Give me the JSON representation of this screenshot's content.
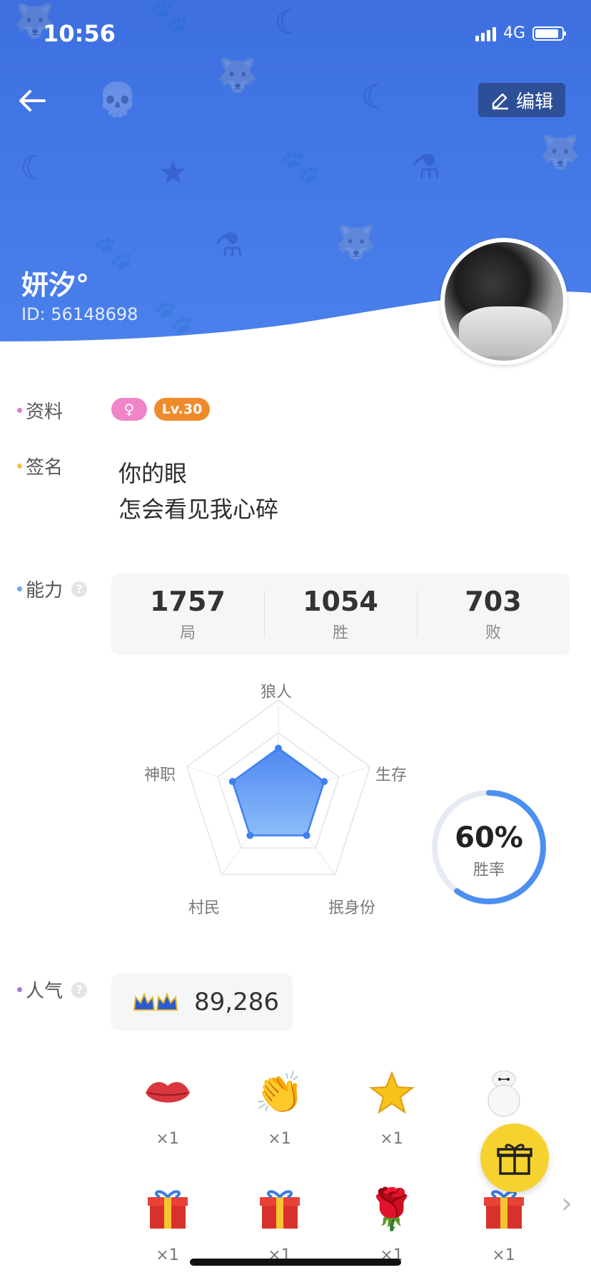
{
  "status_bar": {
    "time": "10:56",
    "network": "4G"
  },
  "header": {
    "edit_label": "编辑",
    "username": "妍汐°",
    "user_id": "ID: 56148698"
  },
  "profile": {
    "label": "资料",
    "level_badge": "Lv.30"
  },
  "signature": {
    "label": "签名",
    "line1": "你的眼",
    "line2": "怎会看见我心碎"
  },
  "ability": {
    "label": "能力",
    "stats": [
      {
        "value": "1757",
        "label": "局"
      },
      {
        "value": "1054",
        "label": "胜"
      },
      {
        "value": "703",
        "label": "败"
      }
    ],
    "radar_axes": [
      "狼人",
      "生存",
      "抿身份",
      "村民",
      "神职"
    ],
    "radar_values": [
      0.5,
      0.5,
      0.5,
      0.5,
      0.5
    ],
    "win_rate_value": "60%",
    "win_rate_label": "胜率",
    "win_rate_fraction": 0.6
  },
  "popularity": {
    "label": "人气",
    "value": "89,286"
  },
  "gifts": {
    "row1": [
      {
        "icon": "lips-icon",
        "count": "×1"
      },
      {
        "icon": "clapping-hands-icon",
        "count": "×1"
      },
      {
        "icon": "star-icon",
        "count": "×1"
      },
      {
        "icon": "robot-icon",
        "count": ""
      }
    ],
    "row2": [
      {
        "icon": "gift-box-icon",
        "count": "×1"
      },
      {
        "icon": "gift-box-icon",
        "count": "×1"
      },
      {
        "icon": "rose-icon",
        "count": "×1"
      },
      {
        "icon": "gift-box-icon",
        "count": "×1"
      }
    ]
  },
  "colors": {
    "header_blue": "#4a80ec",
    "accent_blue": "#4c8ff0",
    "profile_dot": "#e27bd2",
    "signature_dot": "#f5c04a",
    "ability_dot": "#6aaaf5",
    "popularity_dot": "#a07ae0",
    "level_orange": "#f08a2b",
    "gender_pink": "#ef85c7",
    "gift_button_yellow": "#f6d22f"
  }
}
